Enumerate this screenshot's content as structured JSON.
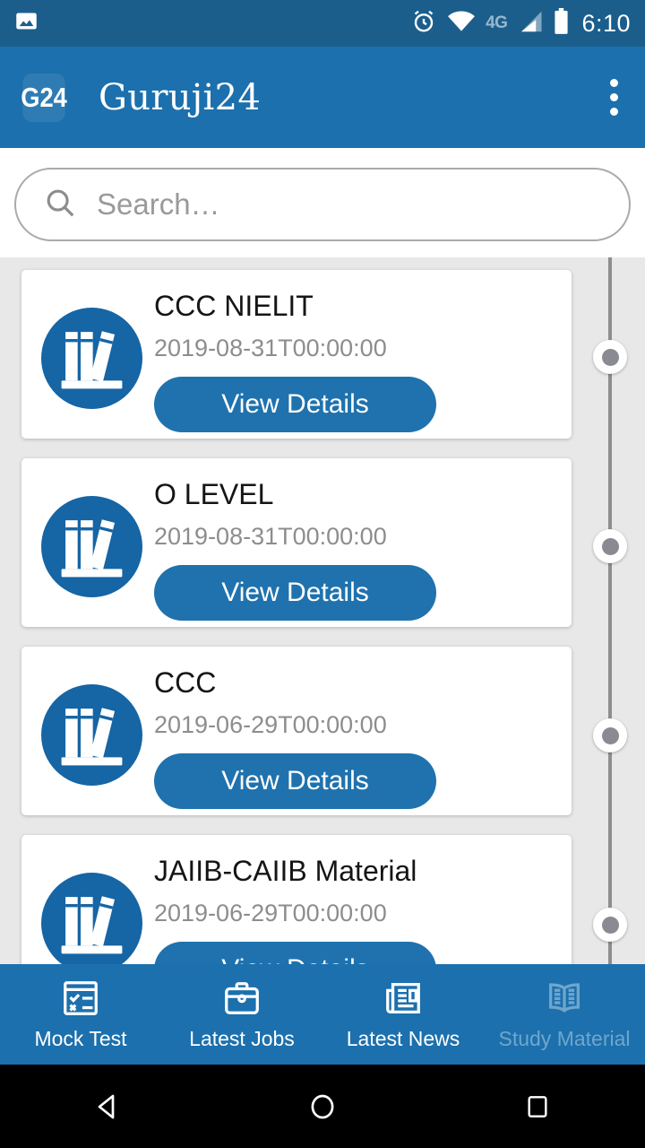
{
  "status_bar": {
    "time": "6:10",
    "network_label": "4G",
    "icons": [
      "image-icon",
      "alarm-icon",
      "wifi-icon",
      "signal-icon",
      "battery-icon"
    ]
  },
  "app_bar": {
    "logo_text": "G24",
    "title": "Guruji24",
    "overflow_label": "More options"
  },
  "search": {
    "placeholder": "Search…",
    "value": ""
  },
  "list": {
    "button_label": "View Details",
    "items": [
      {
        "title": "CCC NIELIT",
        "date": "2019-08-31T00:00:00"
      },
      {
        "title": "O LEVEL",
        "date": "2019-08-31T00:00:00"
      },
      {
        "title": "CCC",
        "date": "2019-06-29T00:00:00"
      },
      {
        "title": "JAIIB-CAIIB Material",
        "date": "2019-06-29T00:00:00"
      }
    ]
  },
  "bottom_nav": {
    "items": [
      {
        "label": "Mock Test",
        "icon": "checklist-icon",
        "active": false
      },
      {
        "label": "Latest Jobs",
        "icon": "briefcase-icon",
        "active": false
      },
      {
        "label": "Latest News",
        "icon": "newspaper-icon",
        "active": false
      },
      {
        "label": "Study Material",
        "icon": "open-book-icon",
        "active": true
      }
    ]
  },
  "system_nav": {
    "back": "back-button",
    "home": "home-button",
    "recents": "recents-button"
  },
  "colors": {
    "status_bar": "#1b5e8c",
    "app_bar": "#1c70ad",
    "accent_button": "#1f72ad",
    "icon_circle": "#1665a5",
    "page_background": "#e8e8e8",
    "active_nav": "#6fa6cc"
  }
}
